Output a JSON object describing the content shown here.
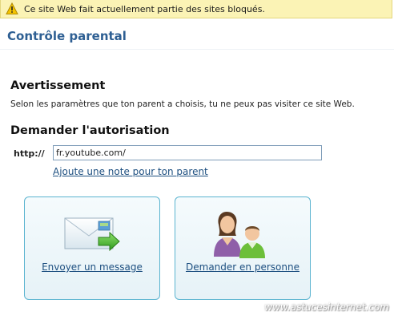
{
  "infobar": {
    "icon": "warning-icon",
    "message": "Ce site Web fait actuellement partie des sites bloqués."
  },
  "page": {
    "title": "Contrôle parental"
  },
  "warning": {
    "heading": "Avertissement",
    "text": "Selon les paramètres que ton parent a choisis, tu ne peux pas visiter ce site Web."
  },
  "request": {
    "heading": "Demander l'autorisation",
    "url_label": "http://",
    "url_value": "fr.youtube.com/",
    "note_link": "Ajoute une note pour ton parent"
  },
  "actions": {
    "send_message": {
      "label": "Envoyer un message",
      "icon": "envelope-send-icon"
    },
    "ask_in_person": {
      "label": "Demander en personne",
      "icon": "parent-child-icon"
    }
  },
  "watermark": "www.astucesinternet.com",
  "colors": {
    "infobar_bg": "#fbf3b5",
    "title": "#2e5f93",
    "link": "#1d4f80",
    "card_border": "#5bb4d0"
  }
}
